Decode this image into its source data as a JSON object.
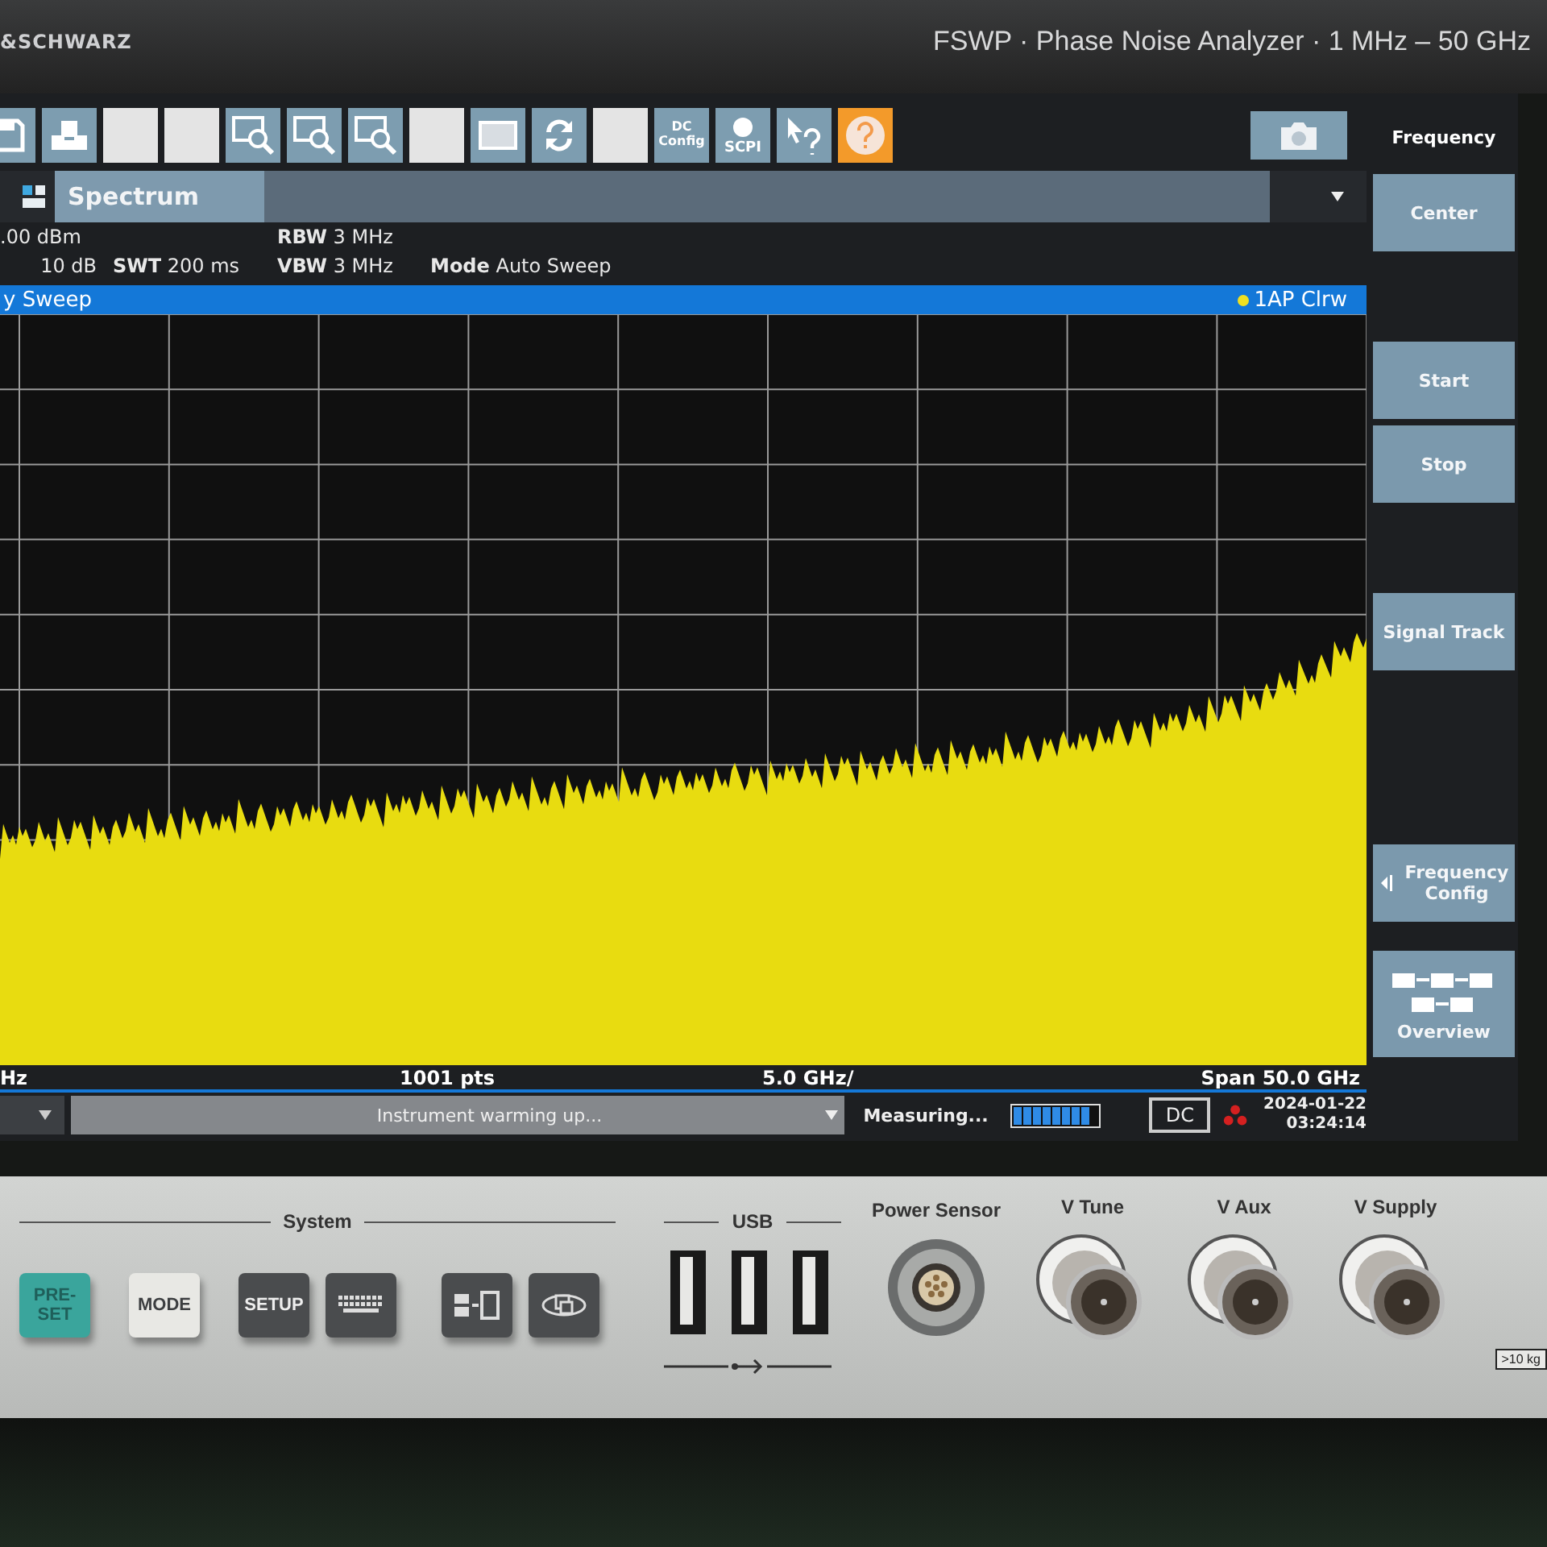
{
  "bezel": {
    "brand": "&SCHWARZ",
    "model": "FSWP · Phase Noise Analyzer · 1 MHz – 50 GHz"
  },
  "toolbar": [
    {
      "kind": "save"
    },
    {
      "kind": "print"
    },
    {
      "kind": "blank"
    },
    {
      "kind": "blank"
    },
    {
      "kind": "zoom"
    },
    {
      "kind": "zoom"
    },
    {
      "kind": "zoom"
    },
    {
      "kind": "blank"
    },
    {
      "kind": "window"
    },
    {
      "kind": "sync"
    },
    {
      "kind": "blank"
    },
    {
      "kind": "text",
      "label": "DC Config"
    },
    {
      "kind": "scpi",
      "label": "SCPI"
    },
    {
      "kind": "whatsthis"
    },
    {
      "kind": "help"
    }
  ],
  "tab": {
    "label": "Spectrum"
  },
  "settings": {
    "ref_level": ".00 dBm",
    "attenuation": "10 dB",
    "swt": {
      "label": "SWT",
      "value": "200 ms"
    },
    "rbw": {
      "label": "RBW",
      "value": "3 MHz"
    },
    "vbw": {
      "label": "VBW",
      "value": "3 MHz"
    },
    "mode": {
      "label": "Mode",
      "value": "Auto Sweep"
    }
  },
  "trace_bar": {
    "title": "y Sweep",
    "trace": "1AP Clrw"
  },
  "plot": {
    "left_label": "Hz",
    "points": "1001 pts",
    "per_division": "5.0 GHz/",
    "span": "Span 50.0 GHz"
  },
  "status": {
    "message": "Instrument warming up...",
    "state": "Measuring...",
    "level": 0.9,
    "coupling": "DC",
    "date": "2024-01-22",
    "time": "03:24:14"
  },
  "softkeys": {
    "title": "Frequency",
    "keys": [
      {
        "kind": "key",
        "label": "Center"
      },
      {
        "kind": "gap"
      },
      {
        "kind": "key",
        "label": "Start"
      },
      {
        "kind": "key",
        "label": "Stop"
      },
      {
        "kind": "gap"
      },
      {
        "kind": "key",
        "label": "Signal Track"
      },
      {
        "kind": "gap"
      },
      {
        "kind": "gap"
      },
      {
        "kind": "config",
        "label": "Frequency Config"
      },
      {
        "kind": "overview",
        "label": "Overview"
      }
    ]
  },
  "panel": {
    "system": {
      "label": "System",
      "keys": [
        {
          "kind": "text",
          "label": "PRE-SET",
          "color": "#3aa59c"
        },
        {
          "kind": "text",
          "label": "MODE",
          "color": "#e8e8e4"
        },
        {
          "kind": "text",
          "label": "SETUP",
          "color": "#4a4c4e"
        },
        {
          "kind": "keyboard",
          "color": "#4a4c4e"
        },
        {
          "kind": "display",
          "color": "#4a4c4e"
        },
        {
          "kind": "windows",
          "color": "#4a4c4e"
        }
      ]
    },
    "usb": {
      "label": "USB"
    },
    "power_sensor": {
      "label": "Power Sensor"
    },
    "connectors": [
      {
        "label": "V Tune"
      },
      {
        "label": "V Aux"
      },
      {
        "label": "V Supply"
      }
    ],
    "weight_warning": ">10 kg"
  }
}
